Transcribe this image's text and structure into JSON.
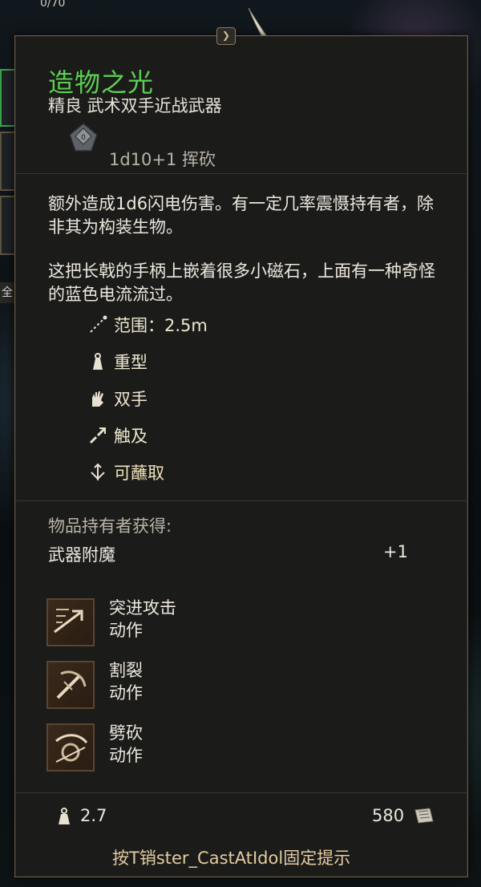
{
  "background": {
    "counter": "0/70",
    "quick_tab": "全"
  },
  "item": {
    "name": "造物之光",
    "subtitle": "精良 武术双手近战武器",
    "damage": "1d10+1 挥砍",
    "dice_icon": "d10-dice-icon",
    "description_1": "额外造成1d6闪电伤害。有一定几率震慑持有者，除非其为构装生物。",
    "description_2": "这把长戟的手柄上嵌着很多小磁石，上面有一种奇怪的蓝色电流流过。",
    "properties": [
      {
        "icon": "range-icon",
        "label": "范围：2.5m"
      },
      {
        "icon": "heavy-icon",
        "label": "重型"
      },
      {
        "icon": "two-handed-icon",
        "label": "双手"
      },
      {
        "icon": "reach-icon",
        "label": "触及"
      },
      {
        "icon": "dippable-icon",
        "label": "可蘸取"
      }
    ],
    "grant_header": "物品持有者获得:",
    "enchantment": {
      "label": "武器附魔",
      "value": "+1"
    },
    "actions": [
      {
        "name": "突进攻击",
        "type": "动作",
        "icon": "lunging-attack-icon"
      },
      {
        "name": "割裂",
        "type": "动作",
        "icon": "lacerate-icon"
      },
      {
        "name": "劈砍",
        "type": "动作",
        "icon": "cleave-icon"
      }
    ],
    "weight": "2.7",
    "price": "580",
    "hint_prefix": "按",
    "hint_key": "T销ster_CastAtIdol",
    "hint_suffix": "固定提示"
  },
  "colors": {
    "rarity_green": "#5ccf52",
    "panel_bg": "#1b1b1a",
    "border_gold": "#6a5c48",
    "hint_gold": "#e3cba0"
  }
}
